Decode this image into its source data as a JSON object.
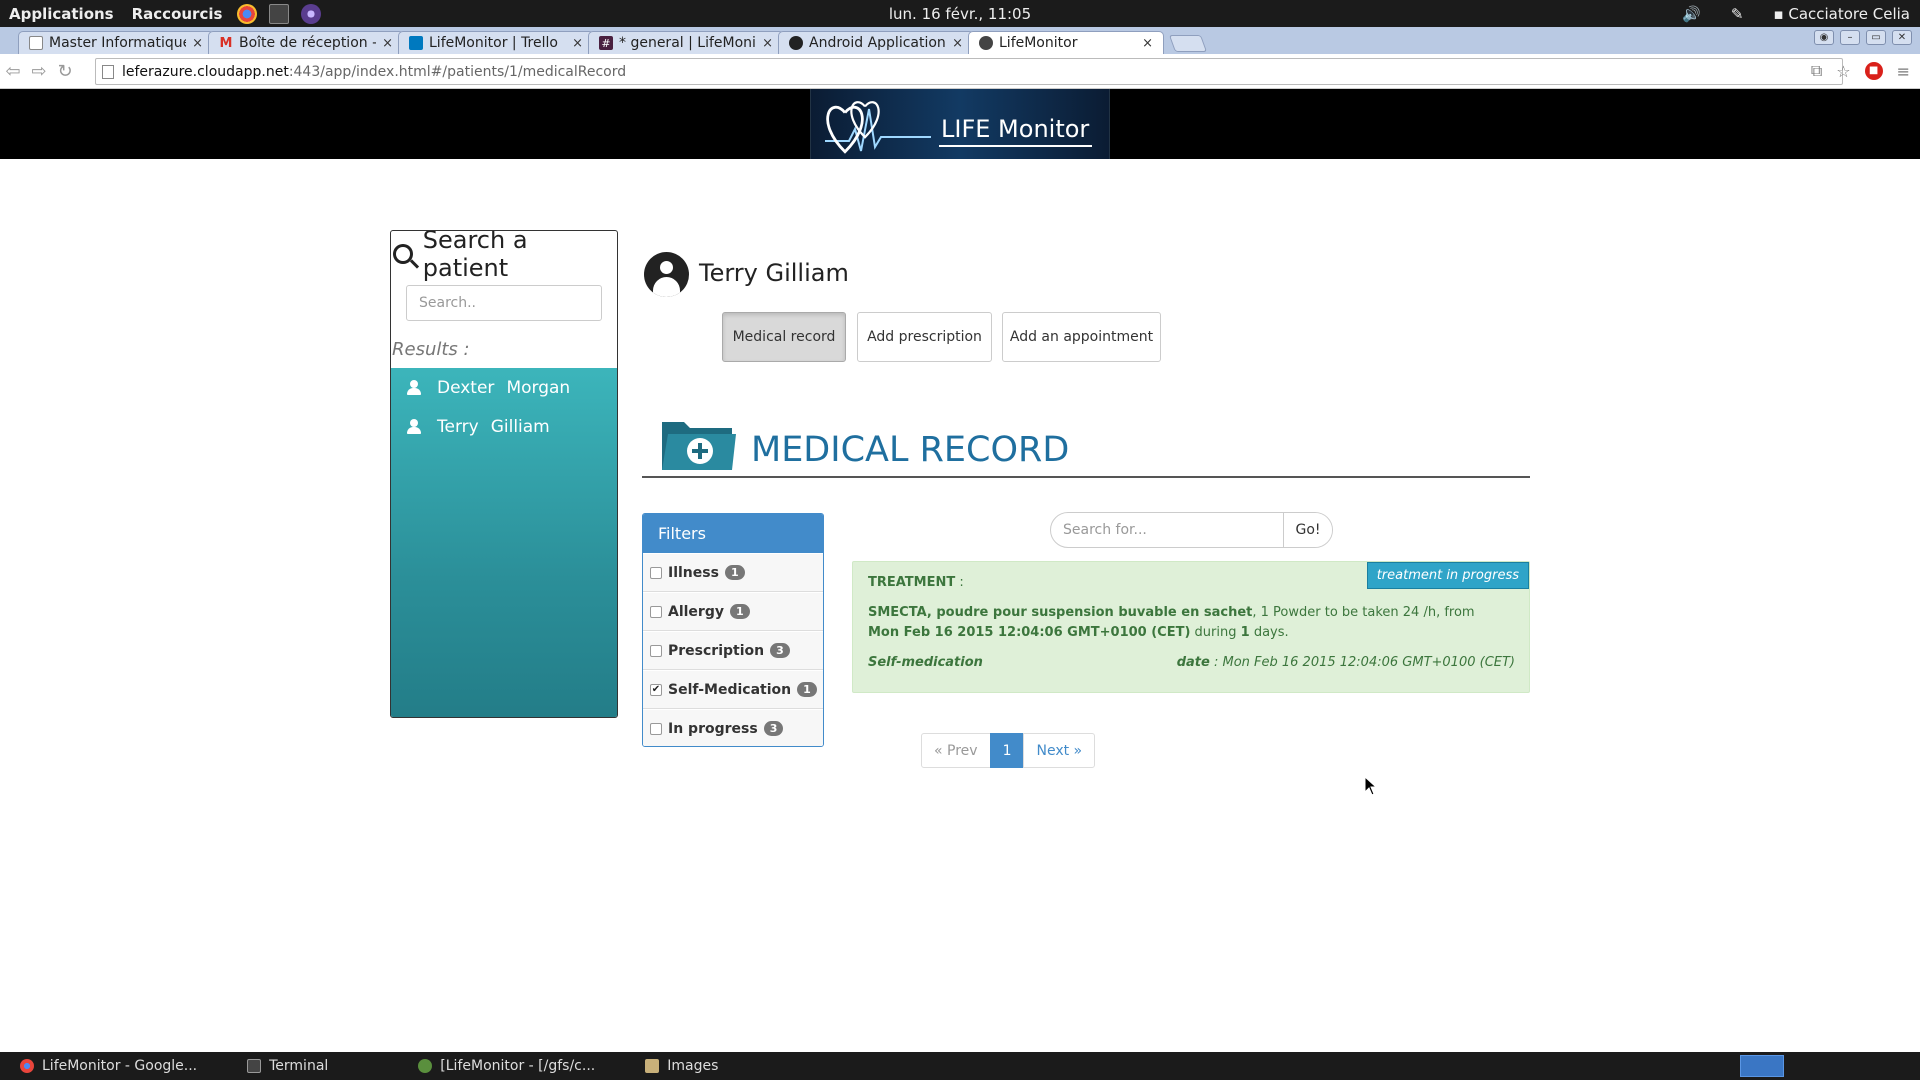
{
  "system": {
    "menu_applications": "Applications",
    "menu_shortcuts": "Raccourcis",
    "clock": "lun. 16 févr., 11:05",
    "user": "Cacciatore Celia"
  },
  "browser": {
    "tabs": [
      {
        "title": "Master Informatique",
        "close": "×"
      },
      {
        "title": "Boîte de réception -",
        "close": "×"
      },
      {
        "title": "LifeMonitor | Trello",
        "close": "×"
      },
      {
        "title": "* general | LifeMoni",
        "close": "×"
      },
      {
        "title": "Android Application",
        "close": "×"
      },
      {
        "title": "LifeMonitor",
        "close": "×"
      }
    ],
    "url_host": "leferazure.cloudapp.net",
    "url_path": ":443/app/index.html#/patients/1/medicalRecord"
  },
  "site": {
    "logo_text": "LIFE Monitor"
  },
  "search_panel": {
    "title": "Search a patient",
    "placeholder": "Search..",
    "results_label": "Results :",
    "results": [
      {
        "first": "Dexter",
        "last": "Morgan"
      },
      {
        "first": "Terry",
        "last": "Gilliam"
      }
    ]
  },
  "patient": {
    "name": "Terry Gilliam",
    "actions": {
      "medical_record": "Medical record",
      "add_prescription": "Add prescription",
      "add_appointment": "Add an appointment"
    }
  },
  "medical_record": {
    "title": "MEDICAL RECORD",
    "filters_title": "Filters",
    "filters": [
      {
        "label": "Illness",
        "count": "1",
        "checked": false
      },
      {
        "label": "Allergy",
        "count": "1",
        "checked": false
      },
      {
        "label": "Prescription",
        "count": "3",
        "checked": false
      },
      {
        "label": "Self-Medication",
        "count": "1",
        "checked": true
      },
      {
        "label": "In progress",
        "count": "3",
        "checked": false
      }
    ],
    "search_placeholder": "Search for...",
    "search_go": "Go!",
    "entry": {
      "status_tag": "treatment in progress",
      "heading": "TREATMENT",
      "heading_suffix": " :",
      "drug": "SMECTA, poudre pour suspension buvable en sachet",
      "dose_text": ", 1 Powder to be taken 24 /h, from ",
      "from_date": "Mon Feb 16 2015 12:04:06 GMT+0100 (CET)",
      "during_text": " during ",
      "duration": "1",
      "days_text": " days.",
      "category": "Self-medication",
      "date_label": "date",
      "date_value": " : Mon Feb 16 2015 12:04:06 GMT+0100 (CET)"
    },
    "pagination": {
      "prev": "« Prev",
      "current": "1",
      "next": "Next »"
    }
  },
  "taskbar": {
    "items": [
      "LifeMonitor - Google...",
      "Terminal",
      "[LifeMonitor - [/gfs/c...",
      "Images"
    ]
  },
  "colors": {
    "brand_blue": "#428bca",
    "teal": "#3cb5bb",
    "success_bg": "#dff0d8",
    "title_blue": "#1f6f9f"
  }
}
